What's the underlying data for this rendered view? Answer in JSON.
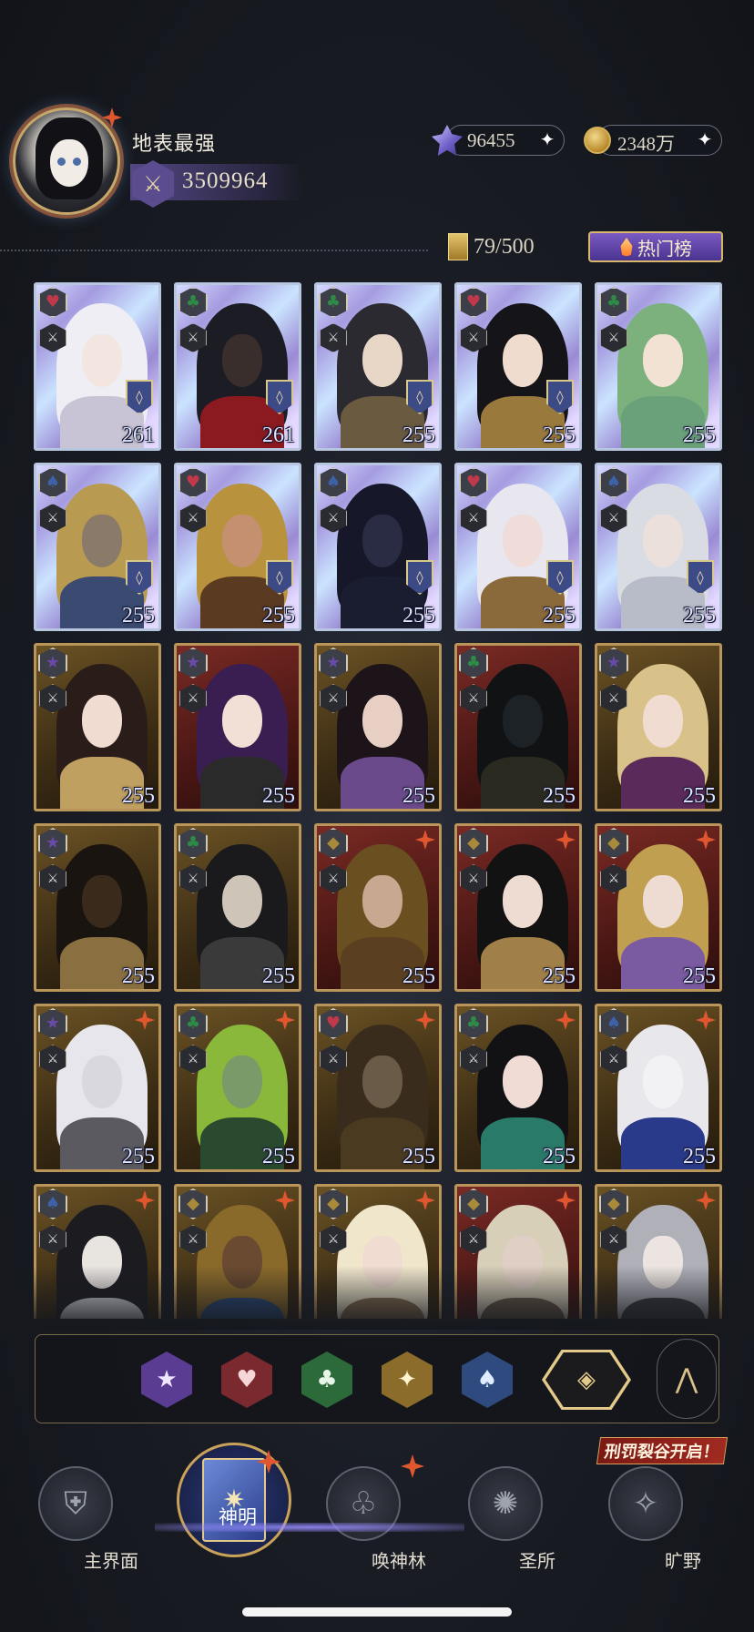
{
  "header": {
    "player_name": "地表最强",
    "power": "3509964",
    "currencies": [
      {
        "icon": "star-gem-icon",
        "value": "96455"
      },
      {
        "icon": "gold-coin-icon",
        "value": "2348万"
      }
    ],
    "card_count": "79/500",
    "hot_list_label": "热门榜"
  },
  "cards": [
    {
      "suit": "♥",
      "suit_color": "#c0394a",
      "frame": "diamond",
      "level": "261",
      "hair": "#eeeef4",
      "skin": "#f3e6e0",
      "body": "#c8c4d6",
      "rank": true
    },
    {
      "suit": "♣",
      "suit_color": "#2e8a46",
      "frame": "diamond",
      "level": "261",
      "hair": "#1b1c24",
      "skin": "#3a2e2c",
      "body": "#8a1a20",
      "rank": true
    },
    {
      "suit": "♣",
      "suit_color": "#2e8a46",
      "frame": "diamond",
      "level": "255",
      "hair": "#2a2a30",
      "skin": "#e8d6c6",
      "body": "#6a5a40",
      "rank": true
    },
    {
      "suit": "♥",
      "suit_color": "#c0394a",
      "frame": "diamond",
      "level": "255",
      "hair": "#151418",
      "skin": "#f0dccf",
      "body": "#9a7a3c",
      "rank": true
    },
    {
      "suit": "♣",
      "suit_color": "#2e8a46",
      "frame": "diamond",
      "level": "255",
      "hair": "#7cb07c",
      "skin": "#f2e2d4",
      "body": "#6aa07a",
      "rank": false
    },
    {
      "suit": "♠",
      "suit_color": "#3e62a8",
      "frame": "diamond",
      "level": "255",
      "hair": "#b89a50",
      "skin": "#8a7a6a",
      "body": "#3a4a70",
      "rank": true
    },
    {
      "suit": "♥",
      "suit_color": "#c0394a",
      "frame": "diamond",
      "level": "255",
      "hair": "#b8923c",
      "skin": "#c49070",
      "body": "#5a3a20",
      "rank": true
    },
    {
      "suit": "♠",
      "suit_color": "#3e62a8",
      "frame": "diamond",
      "level": "255",
      "hair": "#16182a",
      "skin": "#2a2c44",
      "body": "#1a1c30",
      "rank": true
    },
    {
      "suit": "♥",
      "suit_color": "#c0394a",
      "frame": "diamond",
      "level": "255",
      "hair": "#e8e6ee",
      "skin": "#f0dcd8",
      "body": "#8a6a3a",
      "rank": true
    },
    {
      "suit": "♠",
      "suit_color": "#3e62a8",
      "frame": "diamond",
      "level": "255",
      "hair": "#dadce4",
      "skin": "#ece0dc",
      "body": "#b8bcc8",
      "rank": true
    },
    {
      "suit": "★",
      "suit_color": "#6a4aa8",
      "frame": "gold",
      "level": "255",
      "hair": "#2a1c18",
      "skin": "#f0dcd0",
      "body": "#c0a060",
      "rank": false
    },
    {
      "suit": "★",
      "suit_color": "#6a4aa8",
      "frame": "red",
      "level": "255",
      "hair": "#3a1e52",
      "skin": "#f2e0d6",
      "body": "#2a2a2a",
      "rank": false
    },
    {
      "suit": "★",
      "suit_color": "#6a4aa8",
      "frame": "gold",
      "level": "255",
      "hair": "#1c1418",
      "skin": "#e8cfc4",
      "body": "#6a4a8a",
      "rank": false
    },
    {
      "suit": "♣",
      "suit_color": "#2e8a46",
      "frame": "red",
      "level": "255",
      "hair": "#101214",
      "skin": "#1c2226",
      "body": "#2a2a20",
      "rank": false
    },
    {
      "suit": "★",
      "suit_color": "#6a4aa8",
      "frame": "gold",
      "level": "255",
      "hair": "#d8c28a",
      "skin": "#f0dcd0",
      "body": "#5a2a5a",
      "rank": false
    },
    {
      "suit": "★",
      "suit_color": "#6a4aa8",
      "frame": "gold",
      "level": "255",
      "hair": "#1a1410",
      "skin": "#3a2a1c",
      "body": "#8a7040",
      "rank": false
    },
    {
      "suit": "♣",
      "suit_color": "#2e8a46",
      "frame": "gold",
      "level": "255",
      "hair": "#1a1a1c",
      "skin": "#cfc4b8",
      "body": "#3a3a3a",
      "rank": false
    },
    {
      "suit": "◆",
      "suit_color": "#a88a3a",
      "frame": "red",
      "level": "255",
      "hair": "#6a5020",
      "skin": "#c8a890",
      "body": "#5a4020",
      "rank": false,
      "star": true
    },
    {
      "suit": "◆",
      "suit_color": "#a88a3a",
      "frame": "red",
      "level": "255",
      "hair": "#121212",
      "skin": "#eedcd2",
      "body": "#a08048",
      "rank": false,
      "star": true
    },
    {
      "suit": "◆",
      "suit_color": "#a88a3a",
      "frame": "red",
      "level": "255",
      "hair": "#c0a050",
      "skin": "#eedcd2",
      "body": "#7a5aa0",
      "rank": false,
      "star": true
    },
    {
      "suit": "★",
      "suit_color": "#6a4aa8",
      "frame": "gold",
      "level": "255",
      "hair": "#e6e6ec",
      "skin": "#d8d8de",
      "body": "#5a5a60",
      "rank": false,
      "star": true
    },
    {
      "suit": "♣",
      "suit_color": "#2e8a46",
      "frame": "gold",
      "level": "255",
      "hair": "#8ab83a",
      "skin": "#7a9a6a",
      "body": "#2a4a30",
      "rank": false,
      "star": true
    },
    {
      "suit": "♥",
      "suit_color": "#c0394a",
      "frame": "gold",
      "level": "255",
      "hair": "#3a2c1c",
      "skin": "#6a5a48",
      "body": "#4a3a20",
      "rank": false,
      "star": true
    },
    {
      "suit": "♣",
      "suit_color": "#2e8a46",
      "frame": "gold",
      "level": "255",
      "hair": "#121214",
      "skin": "#f0dcd4",
      "body": "#2a7a6a",
      "rank": false,
      "star": true
    },
    {
      "suit": "♠",
      "suit_color": "#3e62a8",
      "frame": "gold",
      "level": "255",
      "hair": "#e8e8ec",
      "skin": "#f2f2f4",
      "body": "#2a3a8a",
      "rank": false,
      "star": true
    },
    {
      "suit": "♠",
      "suit_color": "#3e62a8",
      "frame": "gold",
      "level": "",
      "hair": "#1c1c20",
      "skin": "#e8e4e0",
      "body": "#d8d8dc",
      "rank": false,
      "star": true
    },
    {
      "suit": "◆",
      "suit_color": "#a88a3a",
      "frame": "gold",
      "level": "",
      "hair": "#8a6a2a",
      "skin": "#6a4a30",
      "body": "#2a4a7a",
      "rank": false,
      "star": true
    },
    {
      "suit": "◆",
      "suit_color": "#a88a3a",
      "frame": "gold",
      "level": "",
      "hair": "#f0e6cc",
      "skin": "#f0dcd0",
      "body": "#8a7050",
      "rank": false,
      "star": true
    },
    {
      "suit": "◆",
      "suit_color": "#a88a3a",
      "frame": "red",
      "level": "",
      "hair": "#d8cfb8",
      "skin": "#e0cfc4",
      "body": "#6a5a48",
      "rank": false,
      "star": true
    },
    {
      "suit": "◆",
      "suit_color": "#a88a3a",
      "frame": "gold",
      "level": "",
      "hair": "#b0b0b8",
      "skin": "#ece4e0",
      "body": "#3a3a40",
      "rank": false,
      "star": true
    }
  ],
  "filters": [
    {
      "name": "star",
      "icon": "★"
    },
    {
      "name": "heart",
      "icon": "♥"
    },
    {
      "name": "club",
      "icon": "♣"
    },
    {
      "name": "diamond",
      "icon": "✦"
    },
    {
      "name": "spade",
      "icon": "♠"
    },
    {
      "name": "all",
      "icon": "◈"
    }
  ],
  "nav": {
    "main": "主界面",
    "gods": "神明",
    "summon": "唤神林",
    "sanctuary": "圣所",
    "wild": "旷野",
    "event_banner": "刑罚裂谷开启！"
  }
}
